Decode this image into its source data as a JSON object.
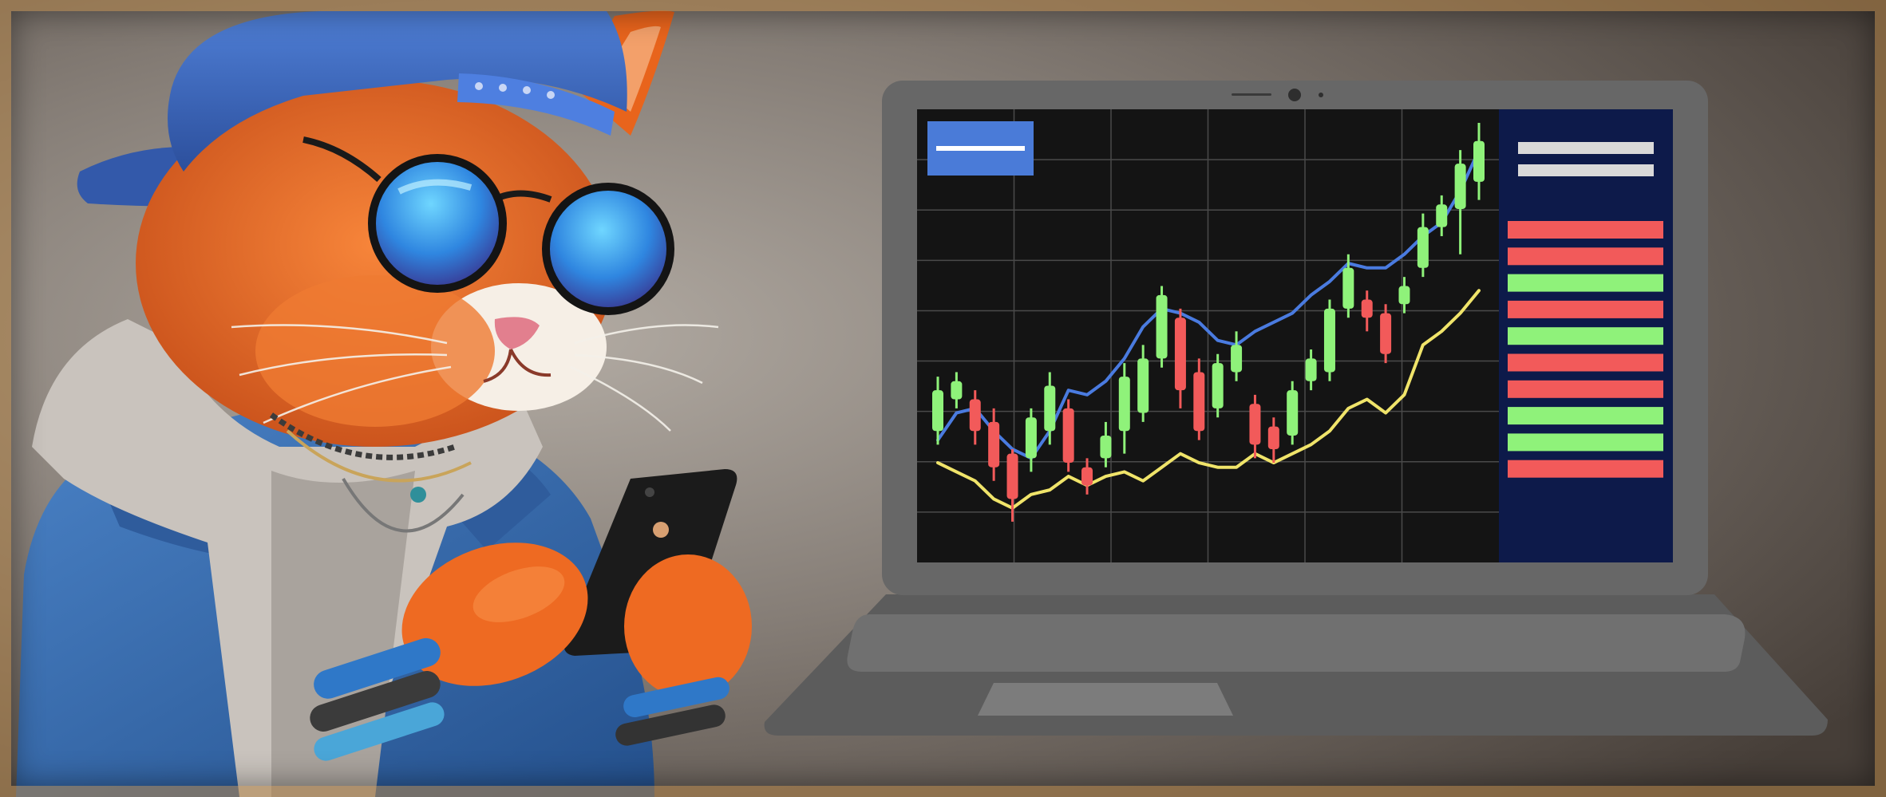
{
  "scene": {
    "subject": "cartoon-cat-trader",
    "colors": {
      "wall_light": "#a49d95",
      "wall_dark": "#4f4741",
      "frame_gold": "#b08246",
      "laptop_body": "#666666",
      "laptop_base": "#5a5a5a",
      "keyboard": "#6e6e6e",
      "trackpad": "#7a7a7a",
      "screen_bg": "#141414",
      "grid_line": "#4a4a4a",
      "side_panel": "#0d1a4a",
      "header_badge": "#4a7bd8",
      "panel_text_bar": "#d9d9d9",
      "bull": "#8ff27a",
      "bear": "#f25a5a",
      "ma_fast": "#4a7be0",
      "ma_slow": "#f0e46a",
      "fur": "#e8641c",
      "cap": "#3a62b8",
      "jacket": "#3b6fb0",
      "hoodie": "#c8c2bc",
      "lens": "#3ea8f0",
      "phone": "#1a1a1a"
    },
    "icons": [
      "webcam-icon"
    ]
  },
  "chart_data": {
    "type": "candlestick",
    "title": "",
    "xlabel": "",
    "ylabel": "",
    "grid": true,
    "ylim": [
      0,
      100
    ],
    "candles": [
      {
        "o": 29,
        "h": 41,
        "l": 26,
        "c": 38
      },
      {
        "o": 36,
        "h": 42,
        "l": 34,
        "c": 40
      },
      {
        "o": 36,
        "h": 38,
        "l": 26,
        "c": 29
      },
      {
        "o": 31,
        "h": 34,
        "l": 18,
        "c": 21
      },
      {
        "o": 24,
        "h": 25,
        "l": 9,
        "c": 14
      },
      {
        "o": 23,
        "h": 34,
        "l": 20,
        "c": 32
      },
      {
        "o": 29,
        "h": 42,
        "l": 26,
        "c": 39
      },
      {
        "o": 34,
        "h": 36,
        "l": 20,
        "c": 22
      },
      {
        "o": 21,
        "h": 23,
        "l": 15,
        "c": 17
      },
      {
        "o": 23,
        "h": 31,
        "l": 21,
        "c": 28
      },
      {
        "o": 29,
        "h": 44,
        "l": 24,
        "c": 41
      },
      {
        "o": 33,
        "h": 48,
        "l": 31,
        "c": 45
      },
      {
        "o": 45,
        "h": 61,
        "l": 43,
        "c": 59
      },
      {
        "o": 54,
        "h": 56,
        "l": 34,
        "c": 38
      },
      {
        "o": 42,
        "h": 45,
        "l": 27,
        "c": 29
      },
      {
        "o": 34,
        "h": 46,
        "l": 32,
        "c": 44
      },
      {
        "o": 42,
        "h": 51,
        "l": 40,
        "c": 48
      },
      {
        "o": 35,
        "h": 37,
        "l": 23,
        "c": 26
      },
      {
        "o": 30,
        "h": 32,
        "l": 22,
        "c": 25
      },
      {
        "o": 28,
        "h": 40,
        "l": 26,
        "c": 38
      },
      {
        "o": 40,
        "h": 47,
        "l": 38,
        "c": 45
      },
      {
        "o": 42,
        "h": 58,
        "l": 40,
        "c": 56
      },
      {
        "o": 56,
        "h": 68,
        "l": 54,
        "c": 65
      },
      {
        "o": 58,
        "h": 60,
        "l": 51,
        "c": 54
      },
      {
        "o": 55,
        "h": 57,
        "l": 44,
        "c": 46
      },
      {
        "o": 57,
        "h": 63,
        "l": 55,
        "c": 61
      },
      {
        "o": 65,
        "h": 77,
        "l": 63,
        "c": 74
      },
      {
        "o": 74,
        "h": 81,
        "l": 72,
        "c": 79
      },
      {
        "o": 78,
        "h": 91,
        "l": 68,
        "c": 88
      },
      {
        "o": 84,
        "h": 97,
        "l": 80,
        "c": 93
      }
    ],
    "series": [
      {
        "kind": "line",
        "color": "#4a7be0",
        "values": [
          27,
          33,
          34,
          29,
          25,
          23,
          29,
          38,
          37,
          40,
          45,
          52,
          56,
          55,
          53,
          49,
          48,
          51,
          53,
          55,
          59,
          62,
          66,
          65,
          65,
          68,
          72,
          75,
          82,
          91
        ]
      },
      {
        "kind": "line",
        "color": "#f0e46a",
        "values": [
          22,
          20,
          18,
          14,
          12,
          15,
          16,
          19,
          17,
          19,
          20,
          18,
          21,
          24,
          22,
          21,
          21,
          24,
          22,
          24,
          26,
          29,
          34,
          36,
          33,
          37,
          48,
          51,
          55,
          60
        ]
      }
    ],
    "order_book": [
      "bear",
      "bear",
      "bull",
      "bear",
      "bull",
      "bear",
      "bear",
      "bull",
      "bull",
      "bear"
    ]
  }
}
